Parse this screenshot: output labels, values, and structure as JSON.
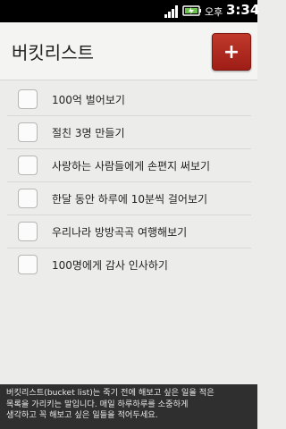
{
  "status_bar": {
    "ampm": "오후",
    "time": "3:34",
    "signal_icon": "signal-bars-icon",
    "battery_icon": "battery-charging-icon"
  },
  "app_bar": {
    "title": "버킷리스트",
    "add_button_label": "+"
  },
  "items": [
    {
      "label": "100억 벌어보기",
      "checked": false
    },
    {
      "label": "절친 3명 만들기",
      "checked": false
    },
    {
      "label": "사랑하는 사람들에게 손편지 써보기",
      "checked": false
    },
    {
      "label": "한달 동안 하루에 10분씩 걸어보기",
      "checked": false
    },
    {
      "label": "우리나라 방방곡곡 여행해보기",
      "checked": false
    },
    {
      "label": "100명에게 감사 인사하기",
      "checked": false
    }
  ],
  "footer": {
    "line1": "버킷리스트(bucket list)는 죽기 전에 해보고 싶은 일을 적은",
    "line2": "목록을 가리키는 말입니다. 매일 하루하루를 소중하게",
    "line3": "생각하고 꼭 해보고 싶은 일들을 적어두세요."
  },
  "colors": {
    "accent": "#a8231a",
    "background": "#ececea",
    "footer_bg": "#2f2f2f"
  }
}
